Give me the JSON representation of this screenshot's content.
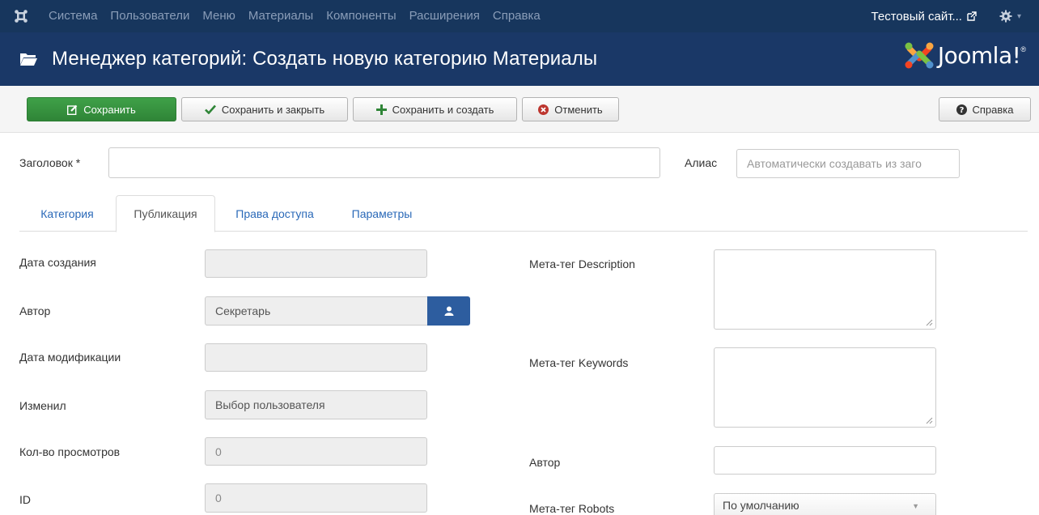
{
  "nav": {
    "items": [
      "Система",
      "Пользователи",
      "Меню",
      "Материалы",
      "Компоненты",
      "Расширения",
      "Справка"
    ],
    "site_link": "Тестовый сайт...",
    "gear_caret": "▾"
  },
  "header": {
    "title": "Менеджер категорий: Создать новую категорию Материалы",
    "logo_text": "Joomla!",
    "logo_reg": "®"
  },
  "toolbar": {
    "save_label": "Сохранить",
    "save_close_label": "Сохранить и закрыть",
    "save_new_label": "Сохранить и создать",
    "cancel_label": "Отменить",
    "help_label": "Справка"
  },
  "form": {
    "title_label": "Заголовок *",
    "title_value": "",
    "alias_label": "Алиас",
    "alias_placeholder": "Автоматически создавать из заго"
  },
  "tabs": [
    {
      "label": "Категория",
      "active": false
    },
    {
      "label": "Публикация",
      "active": true
    },
    {
      "label": "Права доступа",
      "active": false
    },
    {
      "label": "Параметры",
      "active": false
    }
  ],
  "publishing": {
    "created_label": "Дата создания",
    "created_value": "",
    "author_label": "Автор",
    "author_value": "Секретарь",
    "modified_label": "Дата модификации",
    "modified_value": "",
    "modified_by_label": "Изменил",
    "modified_by_value": "Выбор пользователя",
    "hits_label": "Кол-во просмотров",
    "hits_value": "0",
    "id_label": "ID",
    "id_value": "0"
  },
  "metadata": {
    "description_label": "Мета-тег Description",
    "description_value": "",
    "keywords_label": "Мета-тег Keywords",
    "keywords_value": "",
    "author_label": "Автор",
    "author_value": "",
    "robots_label": "Мета-тег Robots",
    "robots_value": "По умолчанию"
  },
  "colors": {
    "navbar": "#17365d",
    "titlebar": "#1a3867",
    "save_green": "#3fa148",
    "link_blue": "#2a69b8",
    "user_button": "#2d5d9f"
  }
}
